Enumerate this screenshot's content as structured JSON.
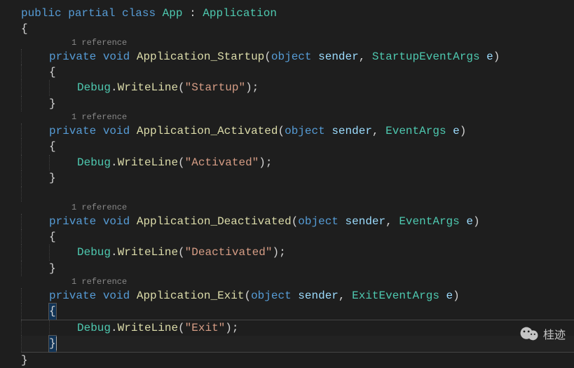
{
  "class_decl": {
    "public": "public",
    "partial": "partial",
    "class": "class",
    "name": "App",
    "colon": " : ",
    "base": "Application"
  },
  "braces": {
    "open": "{",
    "close": "}"
  },
  "ref_hint": "1 reference",
  "method1": {
    "private": "private",
    "void": "void",
    "name": "Application_Startup",
    "lparen": "(",
    "param1_type": "object",
    "param1_name": "sender",
    "comma": ", ",
    "param2_type": "StartupEventArgs",
    "param2_name": "e",
    "rparen": ")",
    "body_class": "Debug",
    "body_dot": ".",
    "body_func": "WriteLine",
    "body_lparen": "(",
    "body_str": "\"Startup\"",
    "body_end": ");"
  },
  "method2": {
    "private": "private",
    "void": "void",
    "name": "Application_Activated",
    "lparen": "(",
    "param1_type": "object",
    "param1_name": "sender",
    "comma": ", ",
    "param2_type": "EventArgs",
    "param2_name": "e",
    "rparen": ")",
    "body_class": "Debug",
    "body_dot": ".",
    "body_func": "WriteLine",
    "body_lparen": "(",
    "body_str": "\"Activated\"",
    "body_end": ");"
  },
  "method3": {
    "private": "private",
    "void": "void",
    "name": "Application_Deactivated",
    "lparen": "(",
    "param1_type": "object",
    "param1_name": "sender",
    "comma": ", ",
    "param2_type": "EventArgs",
    "param2_name": "e",
    "rparen": ")",
    "body_class": "Debug",
    "body_dot": ".",
    "body_func": "WriteLine",
    "body_lparen": "(",
    "body_str": "\"Deactivated\"",
    "body_end": ");"
  },
  "method4": {
    "private": "private",
    "void": "void",
    "name": "Application_Exit",
    "lparen": "(",
    "param1_type": "object",
    "param1_name": "sender",
    "comma": ", ",
    "param2_type": "ExitEventArgs",
    "param2_name": "e",
    "rparen": ")",
    "body_class": "Debug",
    "body_dot": ".",
    "body_func": "WriteLine",
    "body_lparen": "(",
    "body_str": "\"Exit\"",
    "body_end": ");"
  },
  "watermark": "桂迹"
}
